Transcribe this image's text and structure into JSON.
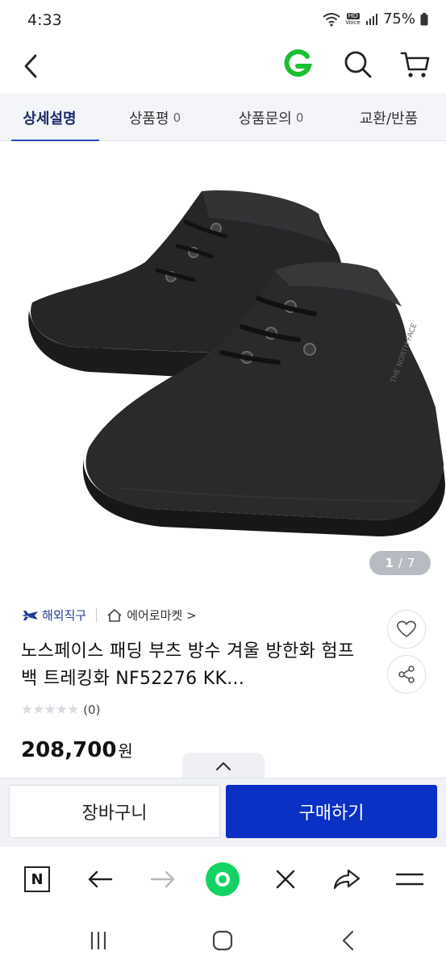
{
  "status": {
    "time": "4:33",
    "battery": "75%",
    "hd_label": "HD",
    "voice_label": "Voice"
  },
  "header": {
    "logo_letter": "G",
    "brand_color": "#19c02f"
  },
  "tabs": [
    {
      "label": "상세설명",
      "count": ""
    },
    {
      "label": "상품평",
      "count": "0"
    },
    {
      "label": "상품문의",
      "count": "0"
    },
    {
      "label": "교환/반품",
      "count": ""
    }
  ],
  "image": {
    "current": "1",
    "sep": "/",
    "total": "7"
  },
  "meta": {
    "overseas": "해외직구",
    "shop": "에어로마켓 >"
  },
  "product": {
    "title": "노스페이스 패딩 부츠 방수 겨울 방한화 험프백 트레킹화 NF52276 KK...",
    "stars": "★★★★★",
    "rating_count": "(0)",
    "price": "208,700",
    "currency": "원"
  },
  "buy_bar": {
    "cart_label": "장바구니",
    "buy_label": "구매하기",
    "buy_color": "#0a30c4"
  },
  "browser": {
    "n_label": "N"
  },
  "icons": [
    "back-icon",
    "search-icon",
    "cart-icon",
    "heart-icon",
    "share-icon",
    "airplane-icon",
    "home-icon",
    "chevron-up-icon",
    "forward-icon",
    "close-icon",
    "send-icon",
    "menu-icon",
    "recents-icon",
    "home-button-icon"
  ]
}
